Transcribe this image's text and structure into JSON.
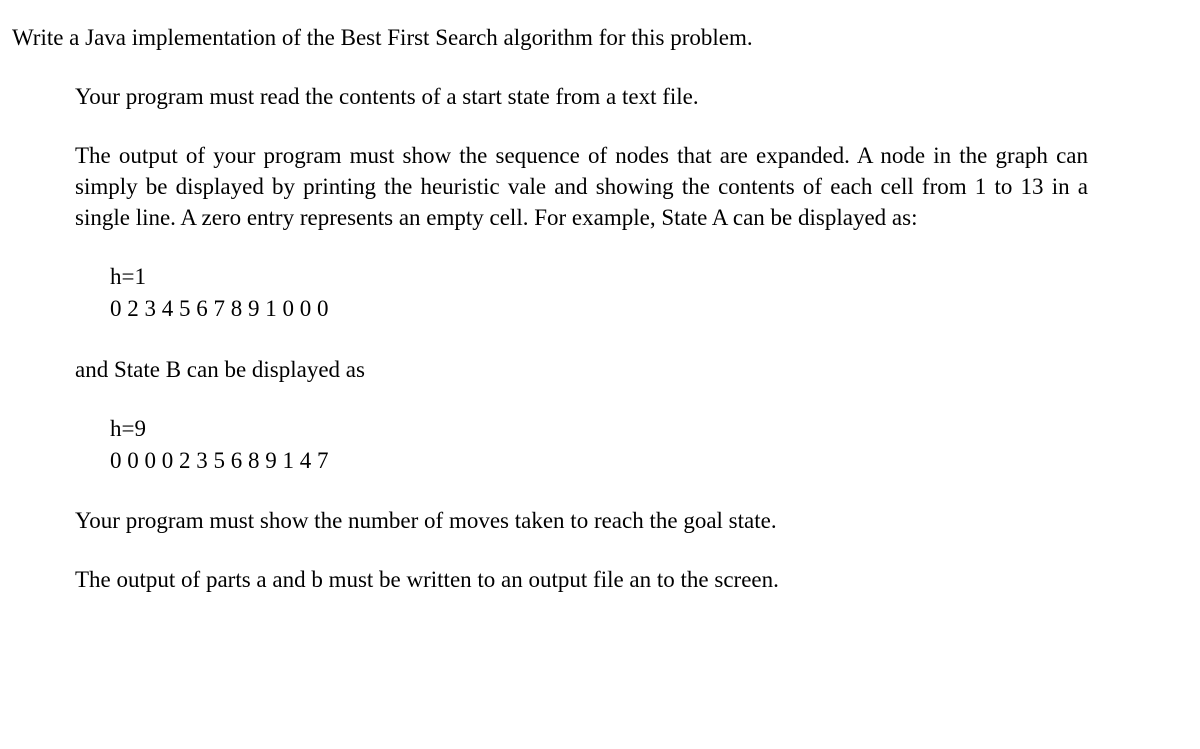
{
  "title": "Write a Java implementation of the Best First Search algorithm for this problem.",
  "para1": "Your program must read the contents of a start state from a text file.",
  "para2": "The output of your program must show the sequence of nodes that are expanded. A node in the graph can simply be displayed by printing the heuristic vale and showing the contents of each cell from 1 to 13 in a single line. A zero entry represents an empty cell. For example, State A can be displayed as:",
  "stateA": {
    "h": "h=1",
    "cells": "0 2 3 4 5 6 7 8 9 1 0 0 0"
  },
  "para3": "and State B can be displayed as",
  "stateB": {
    "h": "h=9",
    "cells": "0 0 0 0 2 3 5 6 8 9 1 4 7"
  },
  "para4": "Your program must show the number of moves taken to reach the goal state.",
  "para5": "The output of parts a and b must be written to an output file an to the screen."
}
